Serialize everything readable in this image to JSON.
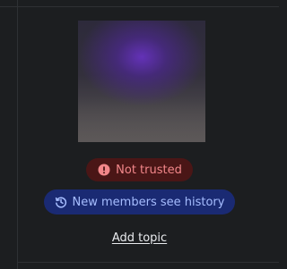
{
  "room_info": {
    "avatar_icon": "room-avatar-image",
    "trust_badge": {
      "label": "Not trusted",
      "icon": "exclamation-circle-icon",
      "text_color": "#f2878a",
      "background_color": "#4a1616"
    },
    "history_badge": {
      "label": "New members see history",
      "icon": "history-icon",
      "text_color": "#a6bdff",
      "background_color": "#1a2a73"
    },
    "add_topic_label": "Add topic"
  }
}
